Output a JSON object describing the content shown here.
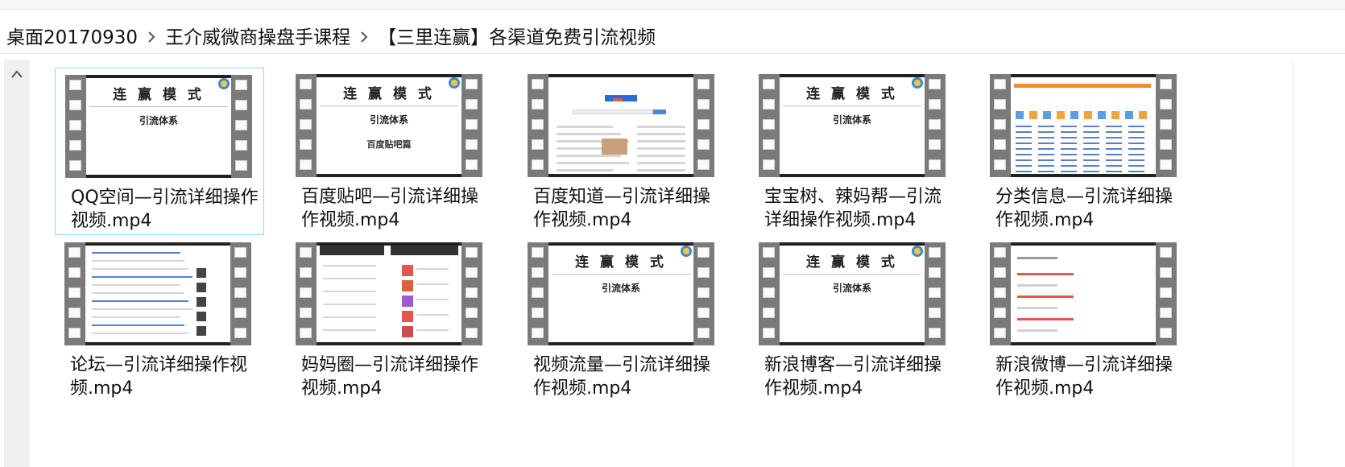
{
  "breadcrumb": {
    "items": [
      "桌面20170930",
      "王介威微商操盘手课程",
      "【三里连赢】各渠道免费引流视频"
    ]
  },
  "files": [
    {
      "name": "QQ空间—引流详细操作视频.mp4",
      "thumb": "slide",
      "slide_title": "连 赢 模 式",
      "slide_sub": "引流体系",
      "slide_sub2": ""
    },
    {
      "name": "百度贴吧—引流详细操作视频.mp4",
      "thumb": "slide",
      "slide_title": "连 赢 模 式",
      "slide_sub": "引流体系",
      "slide_sub2": "百度贴吧篇"
    },
    {
      "name": "百度知道—引流详细操作视频.mp4",
      "thumb": "baidu",
      "slide_title": "",
      "slide_sub": "",
      "slide_sub2": ""
    },
    {
      "name": "宝宝树、辣妈帮—引流详细操作视频.mp4",
      "thumb": "slide",
      "slide_title": "连 赢 模 式",
      "slide_sub": "引流体系",
      "slide_sub2": ""
    },
    {
      "name": "分类信息—引流详细操作视频.mp4",
      "thumb": "portal",
      "slide_title": "",
      "slide_sub": "",
      "slide_sub2": ""
    },
    {
      "name": "论坛—引流详细操作视频.mp4",
      "thumb": "forum",
      "slide_title": "",
      "slide_sub": "",
      "slide_sub2": ""
    },
    {
      "name": "妈妈圈—引流详细操作视频.mp4",
      "thumb": "phone",
      "slide_title": "",
      "slide_sub": "",
      "slide_sub2": ""
    },
    {
      "name": "视频流量—引流详细操作视频.mp4",
      "thumb": "slide",
      "slide_title": "连 赢 模 式",
      "slide_sub": "引流体系",
      "slide_sub2": ""
    },
    {
      "name": "新浪博客—引流详细操作视频.mp4",
      "thumb": "slide",
      "slide_title": "连 赢 模 式",
      "slide_sub": "引流体系",
      "slide_sub2": ""
    },
    {
      "name": "新浪微博—引流详细操作视频.mp4",
      "thumb": "weibo",
      "slide_title": "",
      "slide_sub": "",
      "slide_sub2": ""
    }
  ],
  "selected_index": 0,
  "icons": {
    "separator": "chevron-right-icon",
    "scroll_up": "chevron-up-icon",
    "file_thumbnail": "film-strip-icon"
  },
  "colors": {
    "selection_border": "#99d1ff",
    "film": "#7a7a7a",
    "scrollbar": "#f0f0f0"
  }
}
